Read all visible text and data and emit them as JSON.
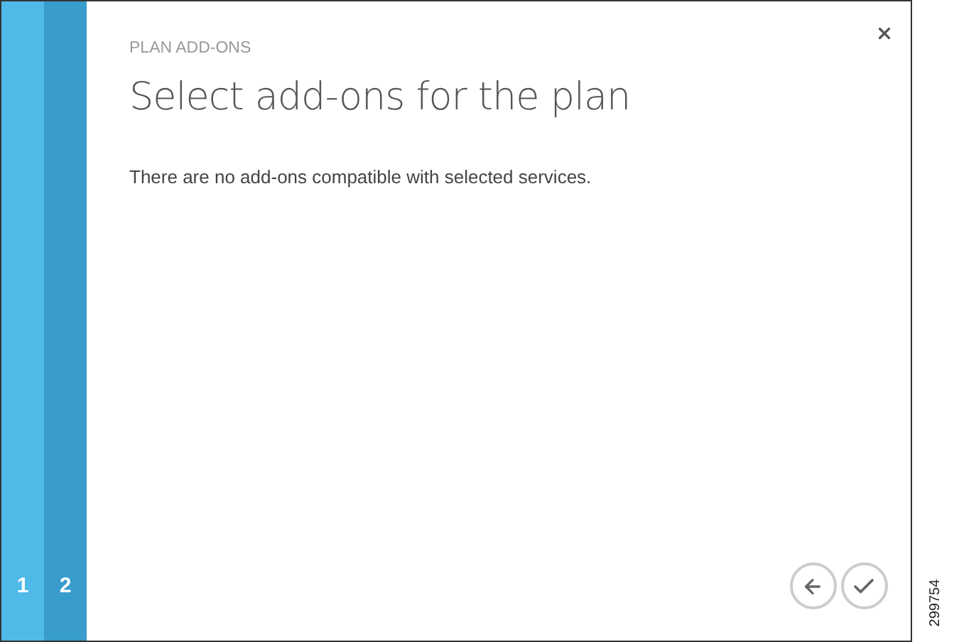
{
  "steps": [
    {
      "label": "1",
      "selected": false
    },
    {
      "label": "2",
      "selected": true
    }
  ],
  "dialog": {
    "section": "PLAN ADD-ONS",
    "title": "Select add-ons for the plan",
    "message": "There are no add-ons compatible with selected services."
  },
  "figure_number": "299754"
}
